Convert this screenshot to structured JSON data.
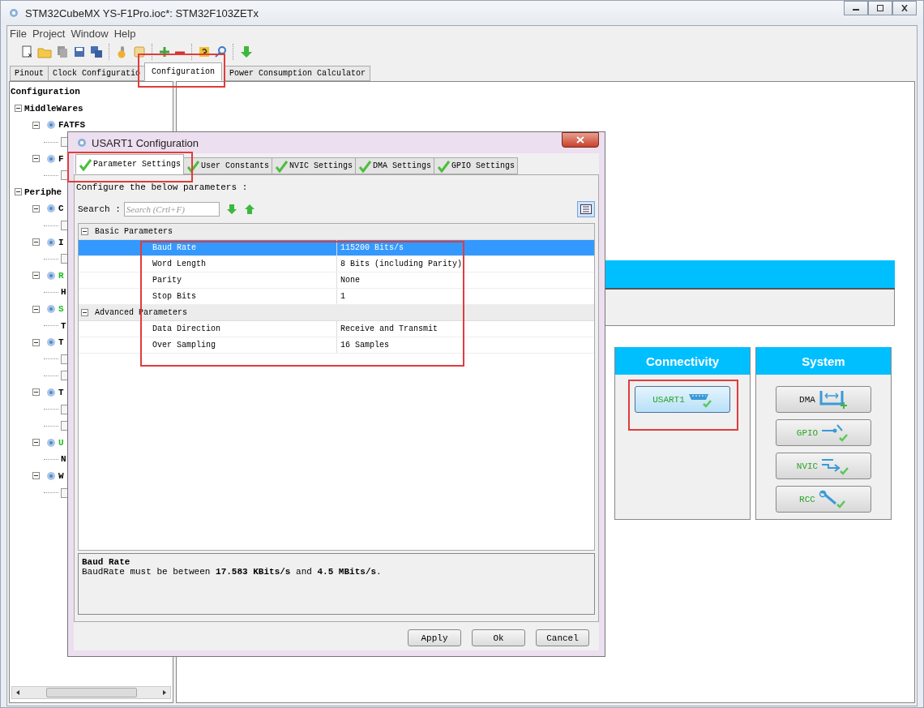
{
  "window": {
    "title": "STM32CubeMX YS-F1Pro.ioc*: STM32F103ZETx"
  },
  "menu": [
    "File",
    "Project",
    "Window",
    "Help"
  ],
  "tabs": [
    {
      "label": "Pinout",
      "selected": false
    },
    {
      "label": "Clock Configuratio",
      "selected": false
    },
    {
      "label": "Configuration",
      "selected": true
    },
    {
      "label": "Power Consumption Calculator",
      "selected": false
    }
  ],
  "tree": {
    "label": "Configuration",
    "children": [
      {
        "kind": "group",
        "label": "MiddleWares",
        "expanded": true,
        "children": [
          {
            "kind": "component",
            "label": "FATFS",
            "color": "#000000",
            "expanded": true,
            "children": [
              {
                "kind": "checkbox",
                "checked": false
              }
            ]
          },
          {
            "kind": "component",
            "label": "F",
            "color": "#000000",
            "expanded": true,
            "children": [
              {
                "kind": "checkbox",
                "checked": false
              }
            ]
          }
        ]
      },
      {
        "kind": "group",
        "label": "Periphe",
        "expanded": true,
        "children": [
          {
            "kind": "component",
            "label": "C",
            "color": "#000000",
            "expanded": true,
            "children": [
              {
                "kind": "checkbox",
                "checked": false
              }
            ]
          },
          {
            "kind": "component",
            "label": "I",
            "color": "#000000",
            "expanded": true,
            "children": [
              {
                "kind": "checkbox",
                "checked": false
              }
            ]
          },
          {
            "kind": "component",
            "label": "R",
            "color": "#22bb22",
            "expanded": true,
            "children": [
              {
                "kind": "leaf",
                "label": "H"
              }
            ]
          },
          {
            "kind": "component",
            "label": "S",
            "color": "#22bb22",
            "expanded": true,
            "children": [
              {
                "kind": "leaf",
                "label": "T"
              }
            ]
          },
          {
            "kind": "component",
            "label": "T",
            "color": "#000000",
            "expanded": true,
            "children": [
              {
                "kind": "checkbox",
                "checked": false
              },
              {
                "kind": "checkbox",
                "checked": false
              }
            ]
          },
          {
            "kind": "component",
            "label": "T",
            "color": "#000000",
            "expanded": true,
            "children": [
              {
                "kind": "checkbox",
                "checked": false
              },
              {
                "kind": "checkbox",
                "checked": false
              }
            ]
          },
          {
            "kind": "component",
            "label": "U",
            "color": "#22bb22",
            "expanded": true,
            "children": [
              {
                "kind": "leaf",
                "label": "N"
              }
            ]
          },
          {
            "kind": "component",
            "label": "W",
            "color": "#000000",
            "expanded": true,
            "children": [
              {
                "kind": "checkbox",
                "checked": false
              }
            ]
          }
        ]
      }
    ]
  },
  "categories": [
    {
      "title": "Connectivity",
      "items": [
        {
          "label": "USART1",
          "configured": true,
          "selected": true
        }
      ]
    },
    {
      "title": "System",
      "items": [
        {
          "label": "DMA",
          "configured": false,
          "selected": false
        },
        {
          "label": "GPIO",
          "configured": true,
          "selected": false
        },
        {
          "label": "NVIC",
          "configured": true,
          "selected": false
        },
        {
          "label": "RCC",
          "configured": true,
          "selected": false
        }
      ]
    }
  ],
  "dialog": {
    "title": "USART1 Configuration",
    "tabs": [
      {
        "label": "Parameter Settings",
        "selected": true
      },
      {
        "label": "User Constants",
        "selected": false
      },
      {
        "label": "NVIC Settings",
        "selected": false
      },
      {
        "label": "DMA Settings",
        "selected": false
      },
      {
        "label": "GPIO Settings",
        "selected": false
      }
    ],
    "intro": "Configure the below parameters :",
    "search": {
      "label": "Search :",
      "placeholder": "Search (Crtl+F)"
    },
    "groups": [
      {
        "label": "Basic Parameters",
        "expanded": true,
        "rows": [
          {
            "name": "Baud Rate",
            "value": "115200 Bits/s",
            "selected": true
          },
          {
            "name": "Word Length",
            "value": "8 Bits (including Parity)",
            "selected": false
          },
          {
            "name": "Parity",
            "value": "None",
            "selected": false
          },
          {
            "name": "Stop Bits",
            "value": "1",
            "selected": false
          }
        ]
      },
      {
        "label": "Advanced Parameters",
        "expanded": true,
        "rows": [
          {
            "name": "Data Direction",
            "value": "Receive and Transmit",
            "selected": false
          },
          {
            "name": "Over Sampling",
            "value": "16 Samples",
            "selected": false
          }
        ]
      }
    ],
    "description": {
      "title": "Baud Rate",
      "text": "BaudRate must be between **17.583 KBits/s** and **4.5 MBits/s**."
    },
    "buttons": [
      "Apply",
      "Ok",
      "Cancel"
    ]
  }
}
